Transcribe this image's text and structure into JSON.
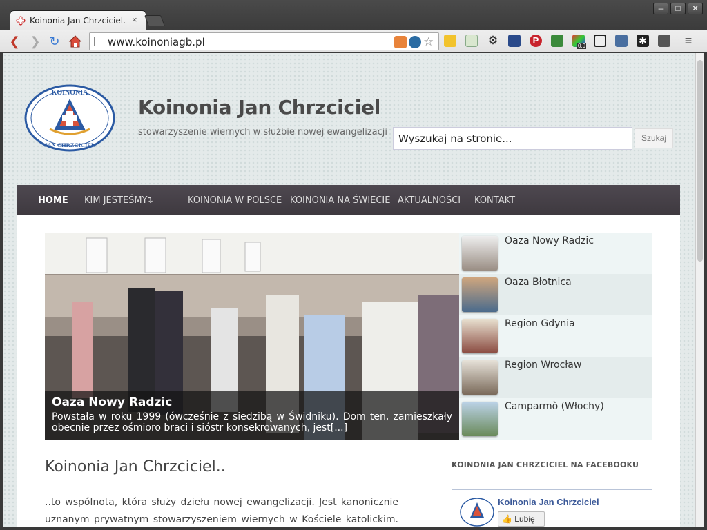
{
  "browser": {
    "tab_title": "Koinonia Jan Chrzciciel...",
    "tab_close": "×",
    "window_controls": {
      "minimize": "–",
      "maximize": "□",
      "close": "✕"
    },
    "url": "www.koinoniagb.pl",
    "nav_icons": [
      "back-icon",
      "forward-icon",
      "reload-icon",
      "home-icon"
    ],
    "omnibox_icons": [
      "rss-icon",
      "wordpress-icon",
      "bookmark-star-icon"
    ],
    "extension_icons": [
      "sticky-note-icon",
      "calendar-icon",
      "settings-gear-icon",
      "puzzle-icon",
      "pinterest-icon",
      "feed-icon",
      "color-icon",
      "tool-icon",
      "camera-icon",
      "asterisk-icon",
      "graph-icon",
      "menu-icon"
    ],
    "extension_badge": "0.9"
  },
  "header": {
    "site_title": "Koinonia Jan Chrzciciel",
    "tagline": "stowarzyszenie wiernych w służbie nowej ewangelizacji",
    "logo_top_text": "KOINONIA",
    "logo_bottom_text": "JAN CHRZCICIEL",
    "search_placeholder": "Wyszukaj na stronie...",
    "search_button": "Szukaj"
  },
  "nav": {
    "items": [
      {
        "label": "HOME"
      },
      {
        "label": "KIM JESTEŚMY"
      },
      {
        "label": "KOINONIA W POLSCE"
      },
      {
        "label": "KOINONIA NA ŚWIECIE"
      },
      {
        "label": "AKTUALNOŚCI"
      },
      {
        "label": "KONTAKT"
      }
    ],
    "dropdown_marker": "↴"
  },
  "slider": {
    "active_title": "Oaza Nowy Radzic",
    "active_text": "Powstała w roku 1999 (ówcześnie z siedzibą w Świdniku). Dom ten, zamieszkały obecnie przez ośmioro braci i sióstr konsekrowanych, jest[...]",
    "items": [
      {
        "label": "Oaza Nowy Radzic"
      },
      {
        "label": "Oaza Błotnica"
      },
      {
        "label": "Region Gdynia"
      },
      {
        "label": "Region Wrocław"
      },
      {
        "label": "Camparmò (Włochy)"
      }
    ]
  },
  "article": {
    "title": "Koinonia Jan Chrzciciel..",
    "text": "..to wspólnota, która służy dziełu nowej ewangelizacji. Jest kanonicznie uznanym prywatnym stowarzyszeniem wiernych w Kościele katolickim. Jej"
  },
  "facebook": {
    "heading": "KOINONIA JAN CHRZCICIEL NA FACEBOOKU",
    "page_name": "Koinonia Jan Chrzciciel",
    "like_button": "Lubię to!"
  }
}
